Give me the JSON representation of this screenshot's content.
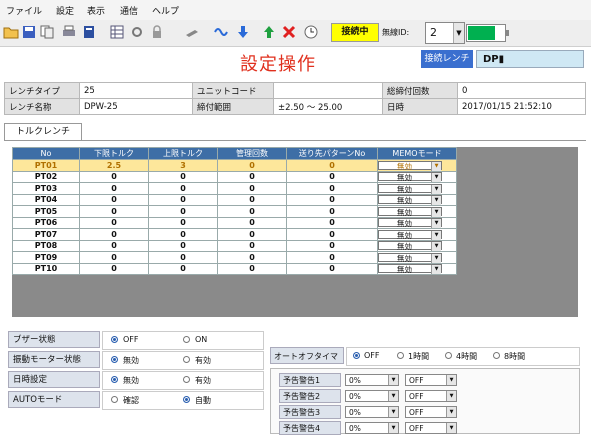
{
  "menu": [
    "ファイル",
    "設定",
    "表示",
    "通信",
    "ヘルプ"
  ],
  "toolbar": {
    "icons": [
      "open-folder-icon",
      "save-icon",
      "copy-icon",
      "print-icon",
      "book-icon",
      "grid-icon",
      "settings-icon",
      "lock-icon",
      "wrench-icon",
      "link-icon",
      "download-icon",
      "upload-icon",
      "delete-icon",
      "clock-icon"
    ],
    "status_badge": "接続中",
    "id_label": "無線ID:",
    "id_value": "2",
    "battery_level": 0.75,
    "battery_color": "#00b050"
  },
  "page_title": "設定操作",
  "connection": {
    "label": "接続レンチ",
    "value": "DP▮"
  },
  "info": {
    "wrench_type_label": "レンチタイプ",
    "wrench_type": "25",
    "unit_code_label": "ユニットコード",
    "unit_code": "",
    "total_count_label": "総締付回数",
    "total_count": "0",
    "wrench_name_label": "レンチ名称",
    "wrench_name": "DPW-25",
    "range_label": "締付範囲",
    "range": "±2.50 〜 25.00",
    "date_label": "日時",
    "date": "2017/01/15 21:52:10"
  },
  "tab_label": "トルクレンチ",
  "grid": {
    "headers": [
      "No",
      "下限トルク",
      "上限トルク",
      "管理回数",
      "送り先パターンNo",
      "MEMOモード"
    ],
    "rows": [
      {
        "no": "PT01",
        "lower": "2.5",
        "upper": "3",
        "count": "0",
        "dest": "0",
        "mode": "無効"
      },
      {
        "no": "PT02",
        "lower": "0",
        "upper": "0",
        "count": "0",
        "dest": "0",
        "mode": "無効"
      },
      {
        "no": "PT03",
        "lower": "0",
        "upper": "0",
        "count": "0",
        "dest": "0",
        "mode": "無効"
      },
      {
        "no": "PT04",
        "lower": "0",
        "upper": "0",
        "count": "0",
        "dest": "0",
        "mode": "無効"
      },
      {
        "no": "PT05",
        "lower": "0",
        "upper": "0",
        "count": "0",
        "dest": "0",
        "mode": "無効"
      },
      {
        "no": "PT06",
        "lower": "0",
        "upper": "0",
        "count": "0",
        "dest": "0",
        "mode": "無効"
      },
      {
        "no": "PT07",
        "lower": "0",
        "upper": "0",
        "count": "0",
        "dest": "0",
        "mode": "無効"
      },
      {
        "no": "PT08",
        "lower": "0",
        "upper": "0",
        "count": "0",
        "dest": "0",
        "mode": "無効"
      },
      {
        "no": "PT09",
        "lower": "0",
        "upper": "0",
        "count": "0",
        "dest": "0",
        "mode": "無効"
      },
      {
        "no": "PT10",
        "lower": "0",
        "upper": "0",
        "count": "0",
        "dest": "0",
        "mode": "無効"
      }
    ]
  },
  "settings": {
    "buzzer": {
      "label": "ブザー状態",
      "opt1": "OFF",
      "opt2": "ON",
      "selected": 1
    },
    "vibration": {
      "label": "振動モーター状態",
      "opt1": "無効",
      "opt2": "有効",
      "selected": 1
    },
    "datetime": {
      "label": "日時設定",
      "opt1": "無効",
      "opt2": "有効",
      "selected": 1
    },
    "auto_mode": {
      "label": "AUTOモード",
      "opt1": "確認",
      "opt2": "自動",
      "selected": 2
    }
  },
  "auto_off": {
    "label": "オートオフタイマ",
    "options": [
      "OFF",
      "1時間",
      "4時間",
      "8時間"
    ],
    "selected": 0
  },
  "warnings": [
    {
      "label": "予告警告1",
      "pct": "0%",
      "state": "OFF"
    },
    {
      "label": "予告警告2",
      "pct": "0%",
      "state": "OFF"
    },
    {
      "label": "予告警告3",
      "pct": "0%",
      "state": "OFF"
    },
    {
      "label": "予告警告4",
      "pct": "0%",
      "state": "OFF"
    }
  ]
}
